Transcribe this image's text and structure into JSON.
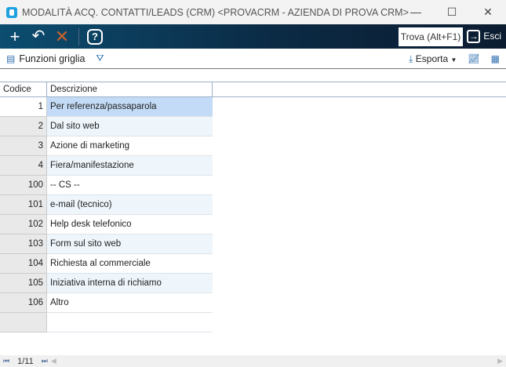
{
  "window": {
    "title": "MODALITÀ ACQ. CONTATTI/LEADS (CRM) <PROVACRM - AZIENDA DI PROVA CRM>"
  },
  "toolbar": {
    "trova_label": "Trova (Alt+F1)",
    "esci_label": "Esci"
  },
  "funcbar": {
    "funzioni_label": "Funzioni griglia",
    "esporta_label": "Esporta"
  },
  "grid": {
    "headers": [
      "Codice",
      "Descrizione"
    ],
    "rows": [
      {
        "code": "1",
        "desc": "Per referenza/passaparola"
      },
      {
        "code": "2",
        "desc": "Dal sito web"
      },
      {
        "code": "3",
        "desc": "Azione di marketing"
      },
      {
        "code": "4",
        "desc": "Fiera/manifestazione"
      },
      {
        "code": "100",
        "desc": "-- CS --"
      },
      {
        "code": "101",
        "desc": "e-mail (tecnico)"
      },
      {
        "code": "102",
        "desc": "Help desk telefonico"
      },
      {
        "code": "103",
        "desc": "Form sul sito web"
      },
      {
        "code": "104",
        "desc": "Richiesta al commerciale"
      },
      {
        "code": "105",
        "desc": "Iniziativa interna di richiamo"
      },
      {
        "code": "106",
        "desc": "Altro"
      }
    ]
  },
  "footer": {
    "page": "1/11"
  }
}
